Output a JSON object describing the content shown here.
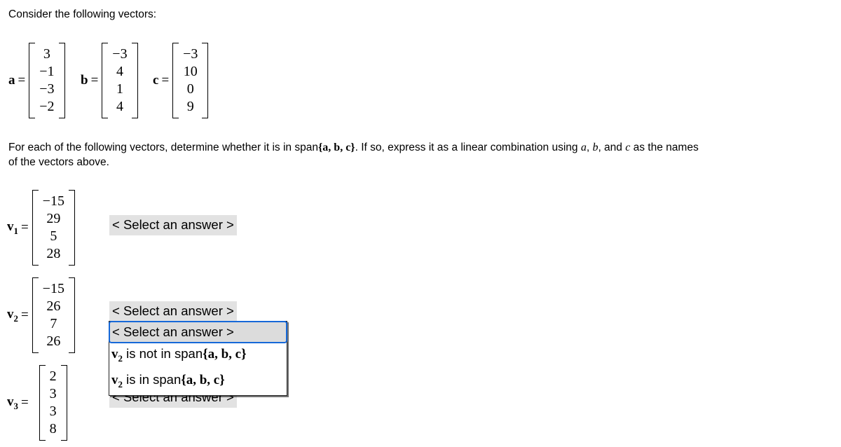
{
  "heading": "Consider the following vectors:",
  "given_vectors": [
    {
      "name": "a",
      "entries": [
        "3",
        "−1",
        "−3",
        "−2"
      ]
    },
    {
      "name": "b",
      "entries": [
        "−3",
        "4",
        "1",
        "4"
      ]
    },
    {
      "name": "c",
      "entries": [
        "−3",
        "10",
        "0",
        "9"
      ]
    }
  ],
  "instructions": {
    "part1": "For each of the following vectors, determine whether it is in span",
    "span_set": "{a, b, c}",
    "part2": ". If so, express it as a linear combination using ",
    "var_a": "a",
    "comma1": ", ",
    "var_b": "b",
    "comma2": ", and ",
    "var_c": "c",
    "part3": " as the names",
    "line2": "of the vectors above."
  },
  "questions": [
    {
      "label": "v",
      "sub": "1",
      "equals": "=",
      "entries": [
        "−15",
        "29",
        "5",
        "28"
      ],
      "answer_value": "< Select an answer >"
    },
    {
      "label": "v",
      "sub": "2",
      "equals": "=",
      "entries": [
        "−15",
        "26",
        "7",
        "26"
      ],
      "answer_value": "< Select an answer >"
    },
    {
      "label": "v",
      "sub": "3",
      "equals": "=",
      "entries": [
        "2",
        "3",
        "3",
        "8"
      ],
      "answer_value": "< Select an answer >"
    }
  ],
  "open_dropdown": {
    "belongs_to": "v2",
    "options": [
      {
        "kind": "placeholder",
        "text": "< Select an answer >",
        "selected": true
      },
      {
        "kind": "math",
        "vec": "v",
        "vec_sub": "2",
        "middle": " is not in span",
        "span_set": "{a, b, c}",
        "selected": false
      },
      {
        "kind": "math",
        "vec": "v",
        "vec_sub": "2",
        "middle": " is in span",
        "span_set": "{a, b, c}",
        "selected": false
      }
    ],
    "highlight_color": "#1668d8"
  }
}
